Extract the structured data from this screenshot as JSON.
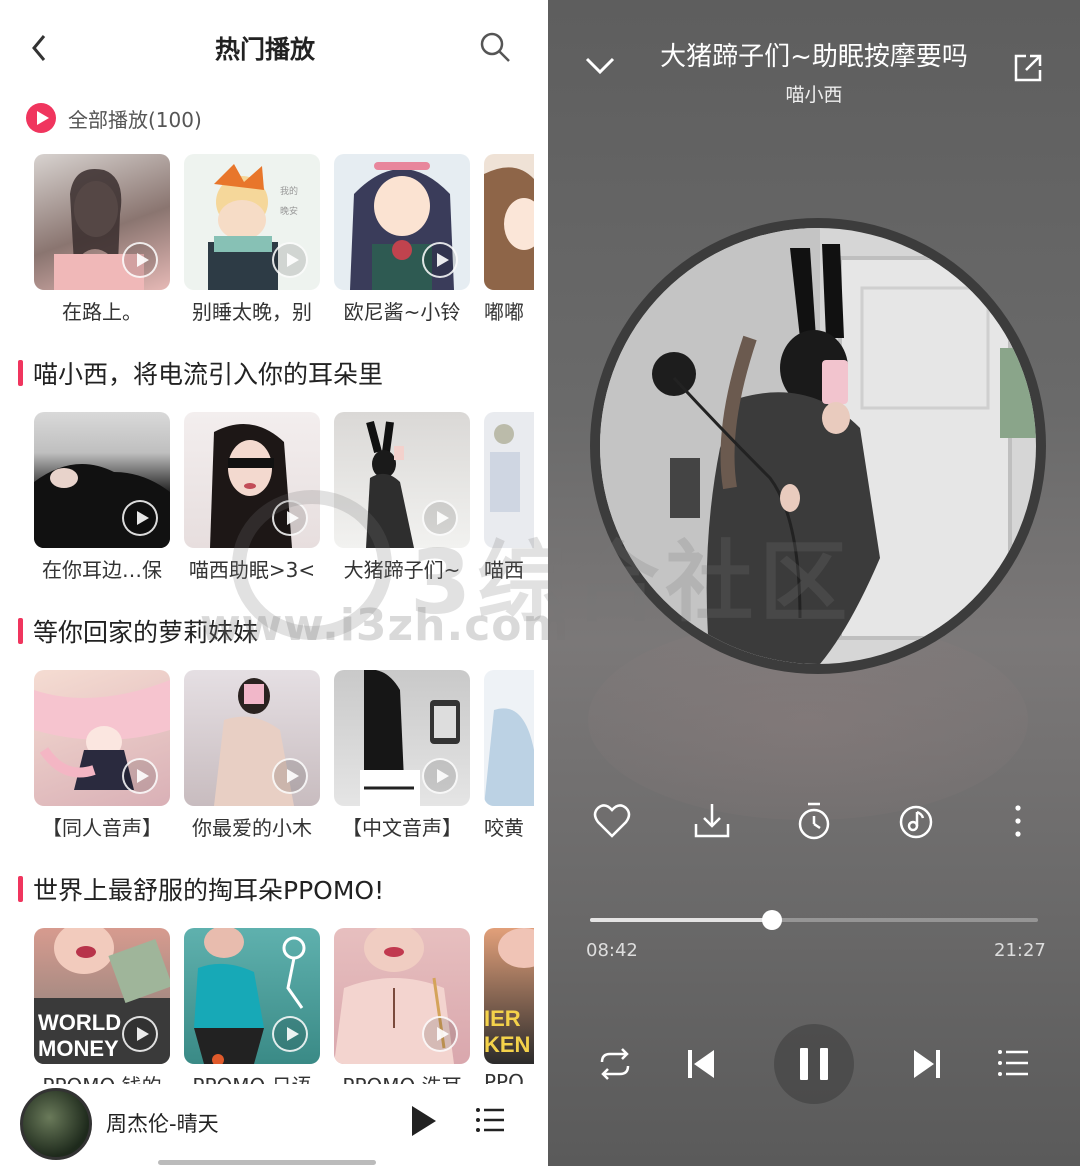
{
  "left": {
    "title": "热门播放",
    "play_all": "全部播放(100)",
    "top_row": [
      {
        "label": "在路上。",
        "thumb": "t1"
      },
      {
        "label": "别睡太晚，别",
        "thumb": "t2"
      },
      {
        "label": "欧尼酱~小铃",
        "thumb": "t3"
      },
      {
        "label": "嘟嘟",
        "thumb": "t4"
      }
    ],
    "sections": [
      {
        "title": "喵小西，将电流引入你的耳朵里",
        "items": [
          {
            "label": "在你耳边…保",
            "thumb": "s1a"
          },
          {
            "label": "喵西助眠>3<",
            "thumb": "s1b"
          },
          {
            "label": "大猪蹄子们~",
            "thumb": "s1c"
          },
          {
            "label": "喵西",
            "thumb": "s1d"
          }
        ]
      },
      {
        "title": "等你回家的萝莉妹妹",
        "items": [
          {
            "label": "【同人音声】",
            "thumb": "s2a"
          },
          {
            "label": "你最爱的小木",
            "thumb": "s2b"
          },
          {
            "label": "【中文音声】",
            "thumb": "s2c"
          },
          {
            "label": "咬黄",
            "thumb": "s2d"
          }
        ]
      },
      {
        "title": "世界上最舒服的掏耳朵PPOMO!",
        "items": [
          {
            "label": "PPOMO 钱的",
            "thumb": "s3a"
          },
          {
            "label": "PPOMO 日语",
            "thumb": "s3b"
          },
          {
            "label": "PPOMO 洗耳",
            "thumb": "s3c"
          },
          {
            "label": "PPO",
            "thumb": "s3d"
          }
        ]
      }
    ],
    "mini_player": {
      "title": "周杰伦-晴天"
    }
  },
  "right": {
    "song_title": "大猪蹄子们~助眠按摩要吗",
    "artist": "喵小西",
    "progress": 0.406,
    "time_current": "08:42",
    "time_total": "21:27",
    "actions": [
      "heart-icon",
      "download-icon",
      "timer-icon",
      "sound-effect-icon",
      "more-icon"
    ],
    "controls": [
      "repeat-icon",
      "previous-icon",
      "pause-icon",
      "next-icon",
      "playlist-icon"
    ]
  },
  "watermark": {
    "text": "www.i3zh.com",
    "cn": "3综合社区"
  },
  "colors": {
    "accent": "#f0355e",
    "player_bg": "#6a6a6a"
  }
}
